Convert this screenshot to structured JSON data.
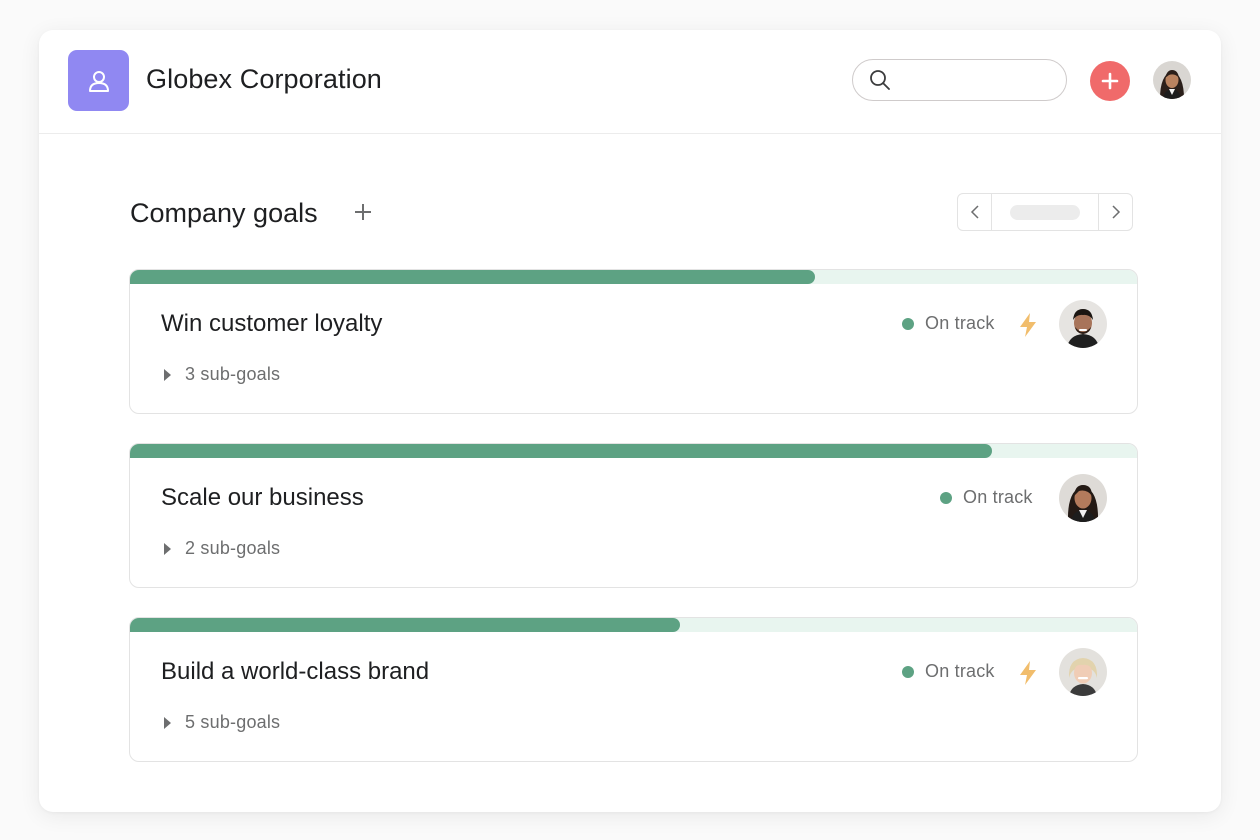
{
  "header": {
    "org_name": "Globex Corporation",
    "search_placeholder": "",
    "icons": {
      "logo": "person-outline-icon",
      "search": "search-icon",
      "add": "plus-icon",
      "avatar": "user-avatar"
    }
  },
  "section": {
    "title": "Company goals",
    "add_icon": "plus-icon",
    "pager": {
      "prev_icon": "chevron-left-icon",
      "next_icon": "chevron-right-icon"
    }
  },
  "goals": [
    {
      "title": "Win customer loyalty",
      "subgoals": "3 sub-goals",
      "status": "On track",
      "progress": 0.68,
      "bolt": true,
      "avatar": "man-dark-hair-avatar"
    },
    {
      "title": "Scale our business",
      "subgoals": "2 sub-goals",
      "status": "On track",
      "progress": 0.856,
      "bolt": false,
      "avatar": "woman-dark-hair-avatar"
    },
    {
      "title": "Build a world-class brand",
      "subgoals": "5 sub-goals",
      "status": "On track",
      "progress": 0.546,
      "bolt": true,
      "avatar": "woman-blonde-hair-avatar"
    }
  ],
  "colors": {
    "logo_bg": "#9088f2",
    "add_button": "#f06a6a",
    "progress_fill": "#5da283",
    "progress_track": "#e8f5ef",
    "status_dot": "#5da283",
    "bolt": "#f1bd6c",
    "text_primary": "#1e1f21",
    "text_secondary": "#6d6e6f"
  }
}
